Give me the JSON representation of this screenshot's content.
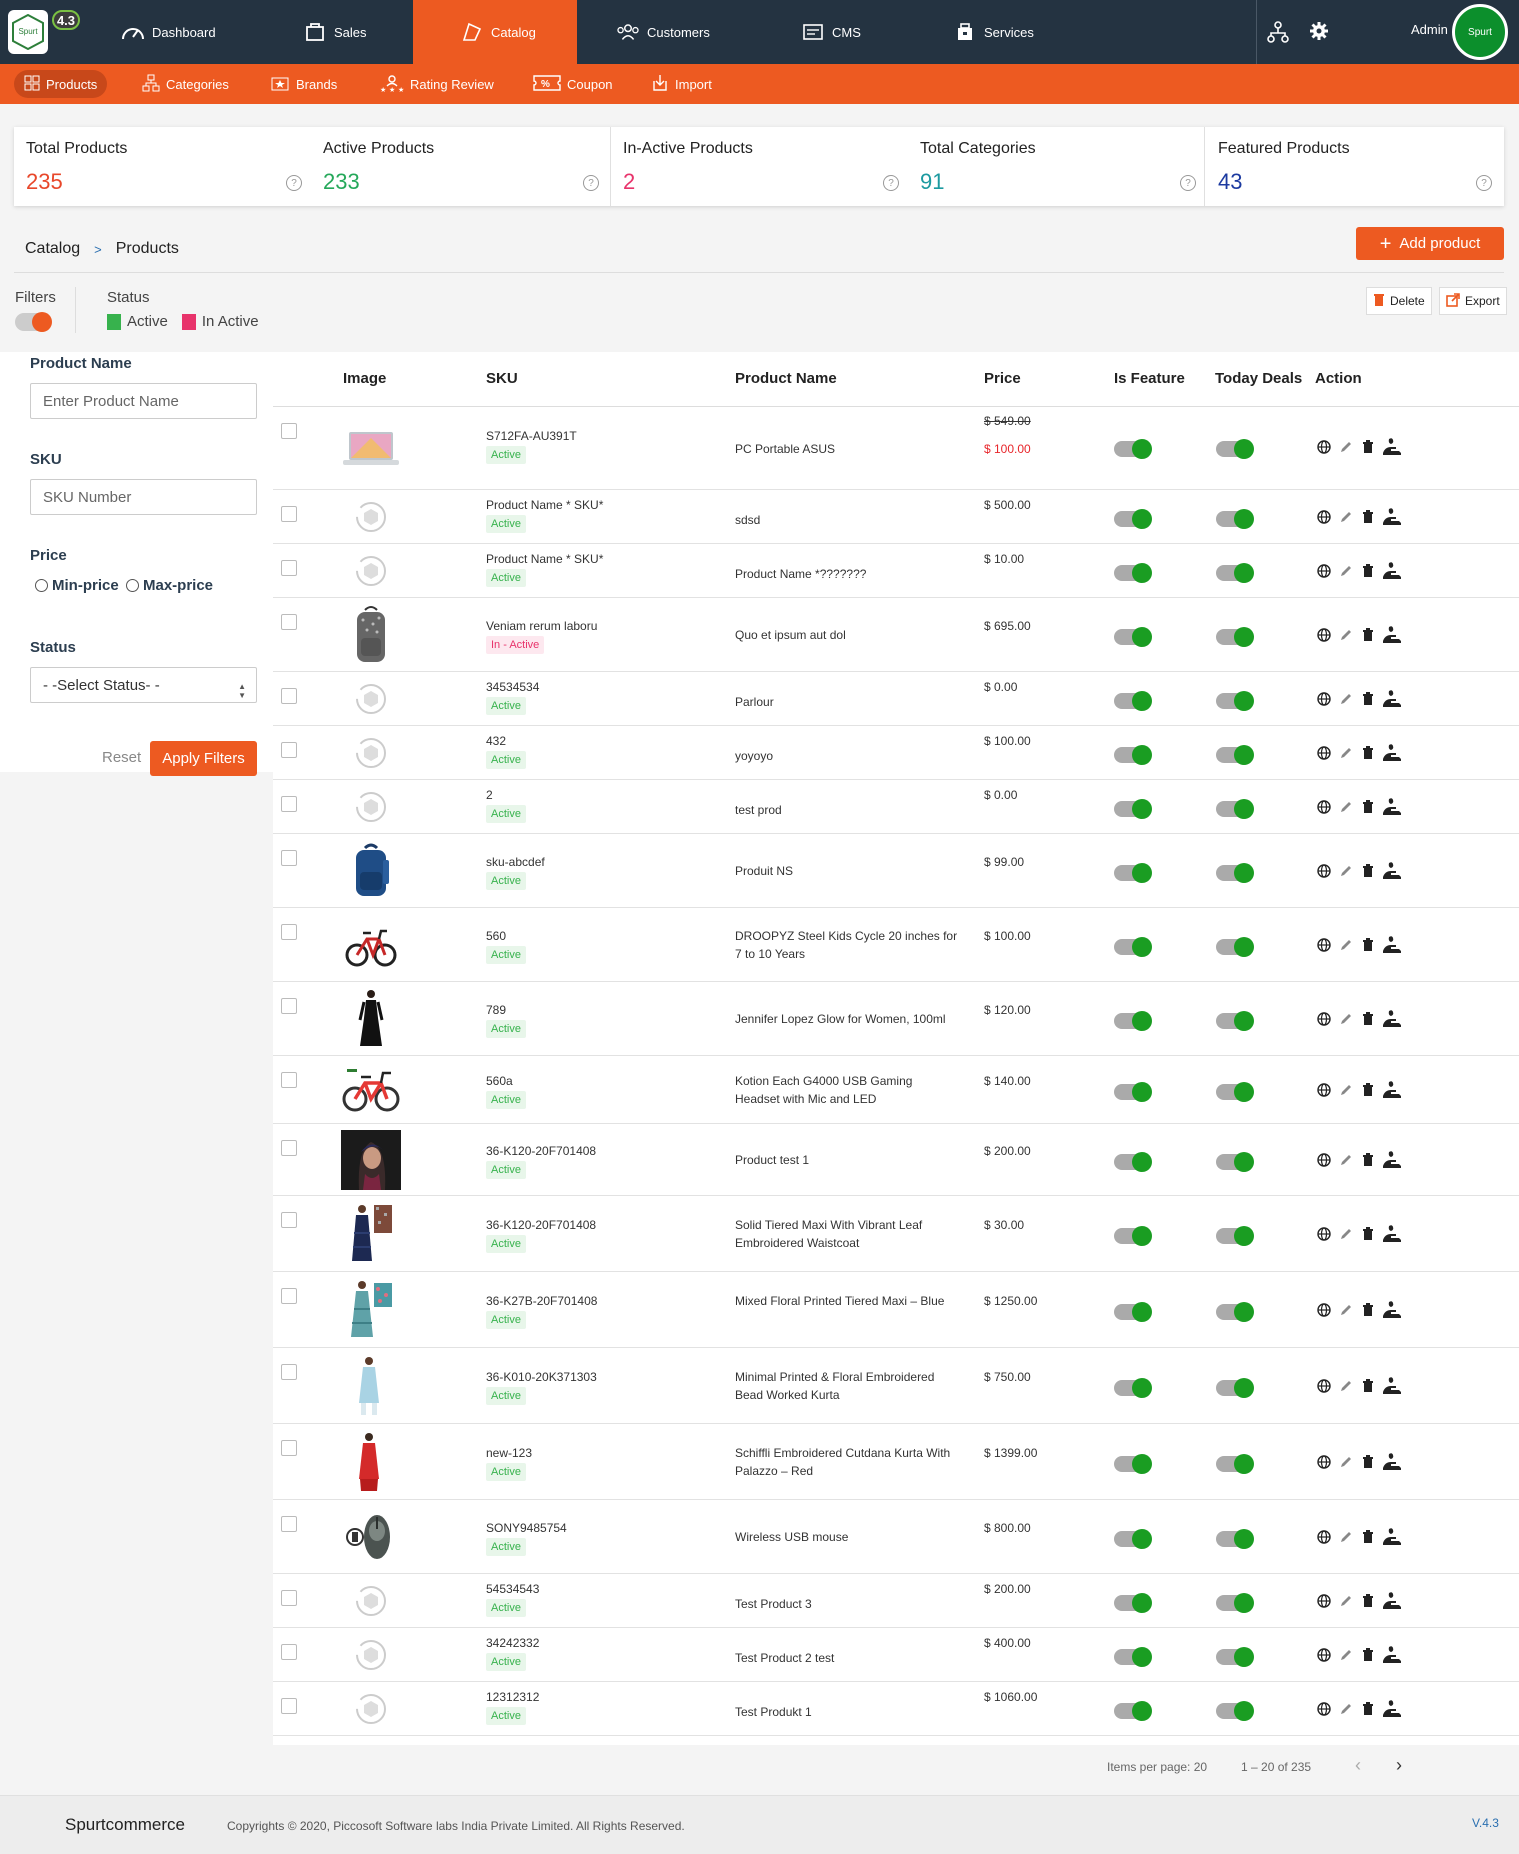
{
  "brand": {
    "logo_text": "Spurt",
    "version_badge": "4.3"
  },
  "topnav": {
    "items": [
      {
        "label": "Dashboard",
        "icon": "dashboard-icon"
      },
      {
        "label": "Sales",
        "icon": "sales-icon"
      },
      {
        "label": "Catalog",
        "icon": "catalog-icon",
        "active": true
      },
      {
        "label": "Customers",
        "icon": "customers-icon"
      },
      {
        "label": "CMS",
        "icon": "cms-icon"
      },
      {
        "label": "Services",
        "icon": "services-icon"
      }
    ],
    "admin_label": "Admin",
    "avatar_text": "Spurt"
  },
  "subnav": {
    "items": [
      {
        "label": "Products",
        "active": true
      },
      {
        "label": "Categories"
      },
      {
        "label": "Brands"
      },
      {
        "label": "Rating Review"
      },
      {
        "label": "Coupon"
      },
      {
        "label": "Import"
      }
    ]
  },
  "stats": [
    {
      "label": "Total Products",
      "value": "235",
      "color": "#e8472a"
    },
    {
      "label": "Active Products",
      "value": "233",
      "color": "#25a85a"
    },
    {
      "label": "In-Active Products",
      "value": "2",
      "color": "#e8336b"
    },
    {
      "label": "Total Categories",
      "value": "91",
      "color": "#1c9aa0"
    },
    {
      "label": "Featured Products",
      "value": "43",
      "color": "#1c3aa0"
    }
  ],
  "breadcrumb": {
    "root": "Catalog",
    "sep": ">",
    "current": "Products"
  },
  "add_button": "Add product",
  "filters": {
    "label": "Filters",
    "status_label": "Status",
    "legend_active": "Active",
    "legend_inactive": "In Active",
    "product_name_label": "Product Name",
    "product_name_placeholder": "Enter Product Name",
    "sku_label": "SKU",
    "sku_placeholder": "SKU Number",
    "price_label": "Price",
    "min_price": "Min-price",
    "max_price": "Max-price",
    "status_select_label": "Status",
    "status_select_value": "- -Select Status- -",
    "reset": "Reset",
    "apply": "Apply Filters"
  },
  "toolbar": {
    "delete": "Delete",
    "export": "Export"
  },
  "table": {
    "headers": [
      "Image",
      "SKU",
      "Product Name",
      "Price",
      "Is Feature",
      "Today Deals",
      "Action"
    ],
    "rows": [
      {
        "image": "laptop",
        "sku": "S712FA-AU391T",
        "status": "Active",
        "name": "PC Portable ASUS",
        "old_price": "$ 549.00",
        "price": "$ 100.00"
      },
      {
        "image": "placeholder",
        "sku": "Product Name * SKU*",
        "status": "Active",
        "name": "sdsd",
        "price": "$ 500.00"
      },
      {
        "image": "placeholder",
        "sku": "Product Name * SKU*",
        "status": "Active",
        "name": "Product Name *???????",
        "price": "$ 10.00"
      },
      {
        "image": "backpack-gray",
        "sku": "Veniam rerum laboru",
        "status": "In - Active",
        "name": "Quo et ipsum aut dol",
        "price": "$ 695.00"
      },
      {
        "image": "placeholder",
        "sku": "34534534",
        "status": "Active",
        "name": "Parlour",
        "price": "$ 0.00"
      },
      {
        "image": "placeholder",
        "sku": "432",
        "status": "Active",
        "name": "yoyoyo",
        "price": "$ 100.00"
      },
      {
        "image": "placeholder",
        "sku": "2",
        "status": "Active",
        "name": "test prod",
        "price": "$ 0.00"
      },
      {
        "image": "backpack-blue",
        "sku": "sku-abcdef",
        "status": "Active",
        "name": "Produit NS",
        "price": "$ 99.00"
      },
      {
        "image": "bicycle",
        "sku": "560",
        "status": "Active",
        "name": "DROOPYZ Steel Kids Cycle 20 inches for 7 to 10 Years",
        "price": "$ 100.00"
      },
      {
        "image": "dress-black",
        "sku": "789",
        "status": "Active",
        "name": "Jennifer Lopez Glow for Women, 100ml",
        "price": "$ 120.00"
      },
      {
        "image": "bicycle-red",
        "sku": "560a",
        "status": "Active",
        "name": "Kotion Each G4000 USB Gaming Headset with Mic and LED",
        "price": "$ 140.00"
      },
      {
        "image": "portrait",
        "sku": "36-K120-20F701408",
        "status": "Active",
        "name": "Product test 1",
        "price": "$ 200.00"
      },
      {
        "image": "maxi-navy",
        "sku": "36-K120-20F701408",
        "status": "Active",
        "name": "Solid Tiered Maxi With Vibrant Leaf Embroidered Waistcoat",
        "price": "$ 30.00"
      },
      {
        "image": "maxi-blue",
        "sku": "36-K27B-20F701408",
        "status": "Active",
        "name": "Mixed Floral Printed Tiered Maxi – Blue",
        "price": "$ 1250.00"
      },
      {
        "image": "kurta-light",
        "sku": "36-K010-20K371303",
        "status": "Active",
        "name": "Minimal Printed & Floral Embroidered Bead Worked Kurta",
        "price": "$ 750.00"
      },
      {
        "image": "kurta-red",
        "sku": "new-123",
        "status": "Active",
        "name": "Schiffli Embroidered Cutdana Kurta With Palazzo – Red",
        "price": "$ 1399.00"
      },
      {
        "image": "mouse",
        "sku": "SONY9485754",
        "status": "Active",
        "name": "Wireless USB mouse",
        "price": "$ 800.00"
      },
      {
        "image": "placeholder",
        "sku": "54534543",
        "status": "Active",
        "name": "Test Product 3",
        "price": "$ 200.00"
      },
      {
        "image": "placeholder",
        "sku": "34242332",
        "status": "Active",
        "name": "Test Product 2 test",
        "price": "$ 400.00"
      },
      {
        "image": "placeholder",
        "sku": "12312312",
        "status": "Active",
        "name": "Test Produkt 1",
        "price": "$ 1060.00"
      }
    ]
  },
  "pagination": {
    "items_per_page": "Items per page: 20",
    "range": "1 – 20 of 235"
  },
  "footer": {
    "brand": "Spurtcommerce",
    "copyright": "Copyrights © 2020, Piccosoft Software labs India Private Limited. All Rights Reserved.",
    "version": "V.4.3"
  },
  "colors": {
    "accent": "#ed5a21",
    "topbar": "#243341",
    "toggle_on": "#1a9d22",
    "active_green": "#37b24d",
    "inactive_pink": "#e8336b"
  }
}
